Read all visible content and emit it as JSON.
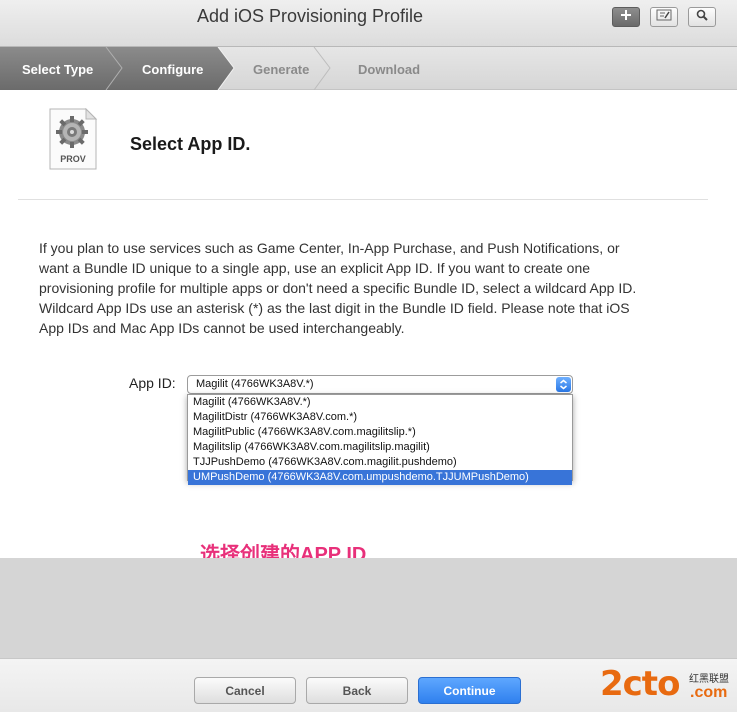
{
  "window": {
    "title": "Add iOS Provisioning Profile"
  },
  "toolbar": {
    "add_icon": "plus-icon",
    "edit_icon": "edit-icon",
    "search_icon": "search-icon"
  },
  "steps": [
    {
      "label": "Select Type",
      "state": "done"
    },
    {
      "label": "Configure",
      "state": "active"
    },
    {
      "label": "Generate",
      "state": "pending"
    },
    {
      "label": "Download",
      "state": "pending"
    }
  ],
  "icon": {
    "label": "PROV"
  },
  "heading": "Select App ID.",
  "description": "If you plan to use services such as Game Center, In-App Purchase, and Push Notifications, or want a Bundle ID unique to a single app, use an explicit App ID. If you want to create one provisioning profile for multiple apps or don't need a specific Bundle ID, select a wildcard App ID. Wildcard App IDs use an asterisk (*) as the last digit in the Bundle ID field. Please note that iOS App IDs and Mac App IDs cannot be used interchangeably.",
  "app_id": {
    "label": "App ID:",
    "selected": "Magilit (4766WK3A8V.*)",
    "options": [
      "Magilit (4766WK3A8V.*)",
      "MagilitDistr (4766WK3A8V.com.*)",
      "MagilitPublic (4766WK3A8V.com.magilitslip.*)",
      "Magilitslip (4766WK3A8V.com.magilitslip.magilit)",
      "TJJPushDemo (4766WK3A8V.com.magilit.pushdemo)",
      "UMPushDemo (4766WK3A8V.com.umpushdemo.TJJUMPushDemo)"
    ],
    "highlighted_index": 5
  },
  "annotation": "选择创建的APP ID",
  "buttons": {
    "cancel": "Cancel",
    "back": "Back",
    "continue": "Continue"
  },
  "watermark": {
    "text": "2cto",
    "domain": ".com",
    "small": "红黑联盟"
  },
  "colors": {
    "accent": "#2f80ee",
    "annotation": "#e8307a",
    "watermark": "#e86a10"
  }
}
